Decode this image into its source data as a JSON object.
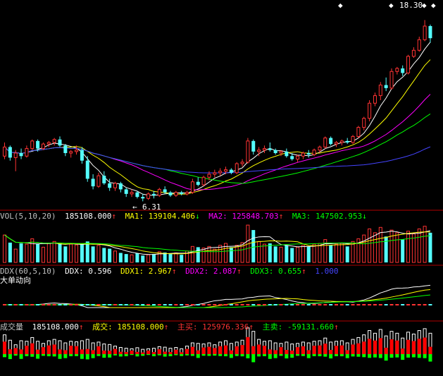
{
  "price": {
    "high_label": "18.30",
    "low_label": "6.31",
    "candles": [
      [
        9.3,
        10.2,
        9.1,
        9.9
      ],
      [
        9.9,
        10.0,
        9.0,
        9.2
      ],
      [
        9.2,
        9.7,
        8.3,
        9.5
      ],
      [
        9.5,
        9.8,
        9.1,
        9.3
      ],
      [
        9.3,
        10.0,
        9.2,
        9.8
      ],
      [
        9.8,
        10.4,
        9.7,
        10.3
      ],
      [
        10.3,
        10.4,
        9.6,
        9.8
      ],
      [
        9.8,
        10.2,
        9.7,
        10.1
      ],
      [
        10.1,
        10.3,
        9.9,
        10.2
      ],
      [
        10.2,
        10.5,
        10.0,
        10.4
      ],
      [
        10.4,
        10.6,
        9.9,
        10.0
      ],
      [
        10.0,
        10.1,
        9.3,
        9.5
      ],
      [
        9.5,
        9.7,
        9.2,
        9.6
      ],
      [
        9.6,
        10.0,
        9.4,
        9.7
      ],
      [
        9.7,
        9.9,
        8.8,
        9.0
      ],
      [
        9.0,
        9.3,
        7.6,
        7.8
      ],
      [
        7.8,
        8.1,
        7.1,
        7.3
      ],
      [
        7.3,
        8.2,
        7.2,
        8.0
      ],
      [
        8.0,
        8.3,
        7.4,
        7.5
      ],
      [
        7.5,
        7.8,
        7.0,
        7.2
      ],
      [
        7.2,
        7.6,
        7.0,
        7.5
      ],
      [
        7.5,
        7.6,
        6.9,
        7.1
      ],
      [
        7.1,
        7.2,
        6.6,
        6.8
      ],
      [
        6.8,
        7.1,
        6.6,
        6.9
      ],
      [
        6.9,
        7.0,
        6.5,
        6.6
      ],
      [
        6.6,
        6.8,
        6.31,
        6.5
      ],
      [
        6.5,
        6.9,
        6.4,
        6.8
      ],
      [
        6.8,
        7.0,
        6.5,
        6.7
      ],
      [
        6.7,
        7.2,
        6.6,
        7.1
      ],
      [
        7.1,
        7.3,
        6.8,
        6.9
      ],
      [
        6.9,
        7.0,
        6.6,
        6.7
      ],
      [
        6.7,
        7.0,
        6.6,
        6.9
      ],
      [
        6.9,
        7.0,
        6.7,
        6.8
      ],
      [
        6.8,
        7.0,
        6.7,
        6.9
      ],
      [
        6.9,
        7.8,
        6.8,
        7.6
      ],
      [
        7.6,
        7.9,
        7.3,
        7.4
      ],
      [
        7.4,
        8.0,
        7.3,
        7.9
      ],
      [
        7.9,
        8.3,
        7.7,
        8.1
      ],
      [
        8.1,
        8.4,
        7.9,
        8.2
      ],
      [
        8.2,
        8.5,
        8.0,
        8.3
      ],
      [
        8.3,
        8.6,
        8.1,
        8.4
      ],
      [
        8.4,
        8.5,
        8.1,
        8.2
      ],
      [
        8.2,
        8.9,
        8.1,
        8.8
      ],
      [
        8.8,
        9.1,
        8.6,
        8.9
      ],
      [
        8.9,
        10.5,
        8.8,
        10.3
      ],
      [
        10.3,
        10.4,
        9.4,
        9.6
      ],
      [
        9.6,
        9.9,
        9.3,
        9.7
      ],
      [
        9.7,
        10.0,
        9.5,
        9.8
      ],
      [
        9.8,
        10.2,
        9.6,
        9.7
      ],
      [
        9.7,
        9.8,
        9.4,
        9.5
      ],
      [
        9.5,
        9.7,
        9.3,
        9.6
      ],
      [
        9.6,
        9.8,
        9.2,
        9.3
      ],
      [
        9.3,
        9.5,
        9.0,
        9.1
      ],
      [
        9.1,
        9.4,
        8.9,
        9.3
      ],
      [
        9.3,
        9.6,
        9.1,
        9.5
      ],
      [
        9.5,
        9.7,
        9.2,
        9.4
      ],
      [
        9.4,
        9.8,
        9.3,
        9.7
      ],
      [
        9.7,
        10.0,
        9.5,
        9.9
      ],
      [
        9.9,
        10.6,
        9.8,
        10.5
      ],
      [
        10.5,
        10.6,
        10.0,
        10.1
      ],
      [
        10.1,
        10.3,
        9.9,
        10.2
      ],
      [
        10.2,
        10.4,
        10.0,
        10.3
      ],
      [
        10.3,
        10.5,
        10.1,
        10.2
      ],
      [
        10.2,
        10.7,
        10.1,
        10.6
      ],
      [
        10.6,
        11.3,
        10.5,
        11.2
      ],
      [
        11.2,
        11.9,
        11.0,
        11.8
      ],
      [
        11.8,
        13.0,
        11.6,
        12.8
      ],
      [
        12.8,
        13.5,
        12.6,
        13.3
      ],
      [
        13.3,
        14.2,
        13.0,
        14.0
      ],
      [
        14.0,
        14.5,
        13.6,
        13.8
      ],
      [
        13.8,
        15.1,
        13.7,
        14.9
      ],
      [
        14.9,
        15.2,
        14.7,
        15.1
      ],
      [
        15.1,
        15.3,
        14.6,
        14.8
      ],
      [
        14.8,
        16.0,
        14.7,
        15.9
      ],
      [
        15.9,
        16.5,
        15.8,
        16.3
      ],
      [
        16.3,
        17.2,
        16.2,
        17.0
      ],
      [
        17.0,
        18.3,
        16.9,
        17.9
      ],
      [
        17.9,
        18.0,
        16.8,
        17.1
      ]
    ]
  },
  "vol_panel": {
    "title": "VOL(5,10,20)",
    "value": "185108.000",
    "ma1_label": "MA1:",
    "ma1_value": "139104.406",
    "ma2_label": "MA2:",
    "ma2_value": "125848.703",
    "ma3_label": "MA3:",
    "ma3_value": "147502.953",
    "arrow_up": "↑",
    "arrow_down": "↓",
    "volumes": [
      0.72,
      0.52,
      0.35,
      0.5,
      0.48,
      0.62,
      0.48,
      0.4,
      0.5,
      0.55,
      0.5,
      0.42,
      0.48,
      0.46,
      0.5,
      0.55,
      0.42,
      0.45,
      0.38,
      0.36,
      0.3,
      0.25,
      0.22,
      0.2,
      0.24,
      0.18,
      0.2,
      0.22,
      0.28,
      0.26,
      0.22,
      0.25,
      0.2,
      0.3,
      0.42,
      0.4,
      0.38,
      0.42,
      0.35,
      0.45,
      0.5,
      0.4,
      0.45,
      0.52,
      0.98,
      0.85,
      0.55,
      0.48,
      0.5,
      0.42,
      0.4,
      0.45,
      0.38,
      0.4,
      0.45,
      0.42,
      0.48,
      0.5,
      0.6,
      0.45,
      0.48,
      0.5,
      0.42,
      0.55,
      0.62,
      0.72,
      0.88,
      0.78,
      0.92,
      0.68,
      0.85,
      0.78,
      0.6,
      0.82,
      0.75,
      0.88,
      0.95,
      0.78
    ]
  },
  "ddx_panel": {
    "title": "DDX(60,5,10)",
    "ddx_label": "DDX:",
    "ddx_value": "0.596",
    "ddx1_label": "DDX1:",
    "ddx1_value": "2.967",
    "ddx2_label": "DDX2:",
    "ddx2_value": "2.087",
    "ddx3_label": "DDX3:",
    "ddx3_value": "0.655",
    "extra_value": "1.000",
    "arrow_up": "↑",
    "subtitle": "大单动向"
  },
  "deal_panel": {
    "title": "成交量",
    "value": "185108.000",
    "deal_label": "成交:",
    "deal_value": "185108.000",
    "buy_label": "主买:",
    "buy_value": "125976.336",
    "sell_label": "主卖:",
    "sell_value": "-59131.660",
    "arrow_up": "↑"
  },
  "colors": {
    "up": "#ff3333",
    "down": "#54ffff",
    "ma1": "#ffffff",
    "ma2": "#ffff00",
    "ma3": "#ff00ff",
    "ma4": "#00ff00",
    "ma5": "#4444ff",
    "axis": "#b00000",
    "buy": "#ff0000",
    "sell": "#00ff00"
  }
}
